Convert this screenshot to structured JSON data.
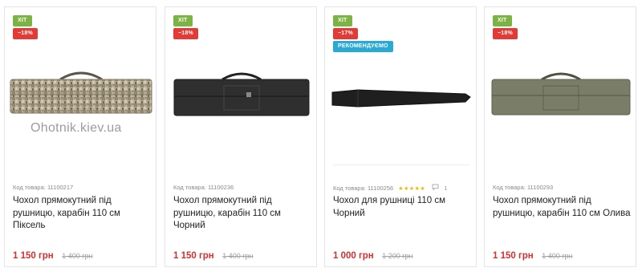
{
  "products": [
    {
      "badges": [
        "ХІТ",
        "−18%"
      ],
      "badge_colors": [
        "#7cb342",
        "#e53935"
      ],
      "watermark": "Ohotnik.kiev.ua",
      "image": "camo-rifle-case",
      "code": "Код товара: 11100217",
      "title": "Чохол прямокутний під рушницю, карабін 110 см Піксель",
      "price": "1 150 грн",
      "old_price": "1 400 грн"
    },
    {
      "badges": [
        "ХІТ",
        "−18%"
      ],
      "badge_colors": [
        "#7cb342",
        "#e53935"
      ],
      "image": "black-rifle-case",
      "code": "Код товара: 11100236",
      "title": "Чохол прямокутний під рушницю, карабін 110 см Чорний",
      "price": "1 150 грн",
      "old_price": "1 400 грн"
    },
    {
      "badges": [
        "ХІТ",
        "−17%",
        "РЕКОМЕНДУЄМО"
      ],
      "badge_colors": [
        "#7cb342",
        "#e53935",
        "#29a9d6"
      ],
      "image": "black-rifle-sleeve",
      "code": "Код товара: 11100256",
      "rating_stars": "★★★★★",
      "review_count": "1",
      "title": "Чохол для рушниці 110 см Чорний",
      "price": "1 000 грн",
      "old_price": "1 200 грн"
    },
    {
      "badges": [
        "ХІТ",
        "−18%"
      ],
      "badge_colors": [
        "#7cb342",
        "#e53935"
      ],
      "image": "olive-rifle-case",
      "code": "Код товара: 11100293",
      "title": "Чохол прямокутний під рушницю, карабін 110 см Олива",
      "price": "1 150 грн",
      "old_price": "1 400 грн"
    }
  ]
}
